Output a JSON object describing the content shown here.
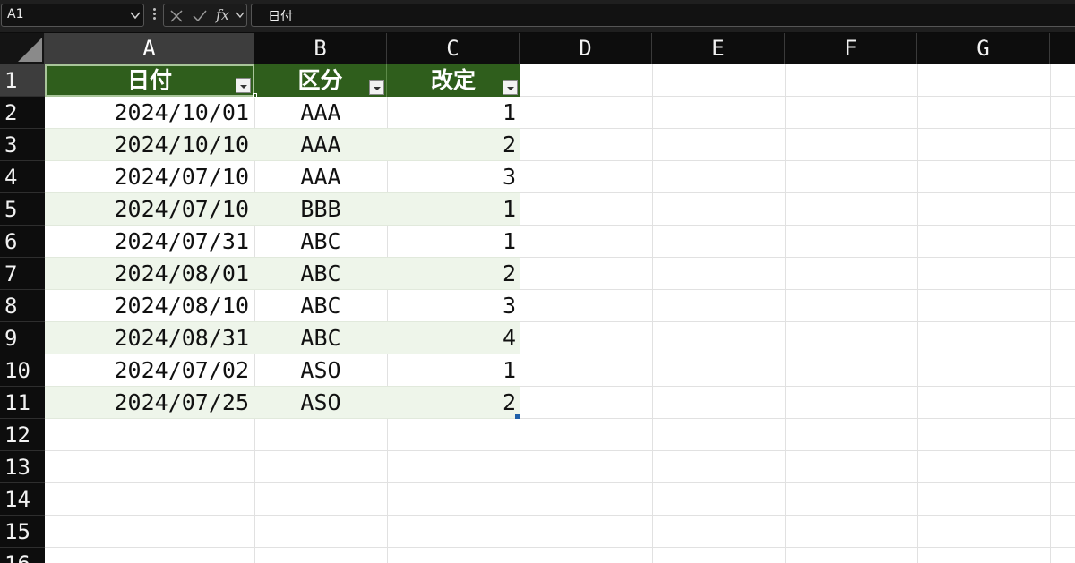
{
  "formula_bar": {
    "name_box": "A1",
    "fx_label": "fx",
    "content": "日付"
  },
  "columns": [
    "A",
    "B",
    "C",
    "D",
    "E",
    "F",
    "G"
  ],
  "rows": [
    "1",
    "2",
    "3",
    "4",
    "5",
    "6",
    "7",
    "8",
    "9",
    "10",
    "11",
    "12",
    "13",
    "14",
    "15",
    "16"
  ],
  "table": {
    "headers": [
      "日付",
      "区分",
      "改定"
    ],
    "rows": [
      [
        "2024/10/01",
        "AAA",
        "1"
      ],
      [
        "2024/10/10",
        "AAA",
        "2"
      ],
      [
        "2024/07/10",
        "AAA",
        "3"
      ],
      [
        "2024/07/10",
        "BBB",
        "1"
      ],
      [
        "2024/07/31",
        "ABC",
        "1"
      ],
      [
        "2024/08/01",
        "ABC",
        "2"
      ],
      [
        "2024/08/10",
        "ABC",
        "3"
      ],
      [
        "2024/08/31",
        "ABC",
        "4"
      ],
      [
        "2024/07/02",
        "ASO",
        "1"
      ],
      [
        "2024/07/25",
        "ASO",
        "2"
      ]
    ]
  },
  "colors": {
    "table_header": "#2f5e1c",
    "band_row": "#eef5ea",
    "header_bar": "#0d0d0d"
  },
  "icons": [
    "chevron-down-icon",
    "cancel-icon",
    "enter-icon",
    "fx-icon",
    "filter-dropdown-icon",
    "select-all-icon"
  ]
}
